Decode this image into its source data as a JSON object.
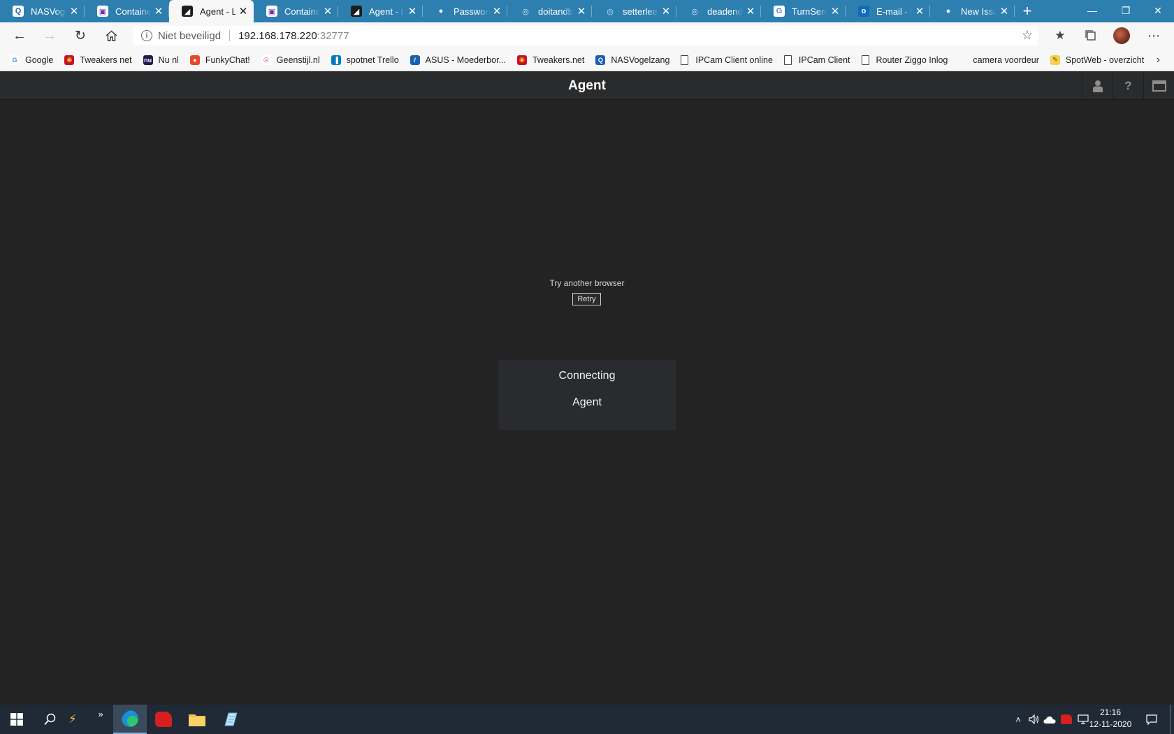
{
  "browser": {
    "tabs": [
      {
        "title": "NASVogelzang",
        "favicon": "nas-icon",
        "active": false
      },
      {
        "title": "Container",
        "favicon": "container-icon",
        "active": false
      },
      {
        "title": "Agent - Lo",
        "favicon": "agent-icon",
        "active": true
      },
      {
        "title": "Container",
        "favicon": "container-icon",
        "active": false
      },
      {
        "title": "Agent - Lo",
        "favicon": "agent-icon",
        "active": false
      },
      {
        "title": "Password",
        "favicon": "github-icon",
        "active": false
      },
      {
        "title": "doitandbe",
        "favicon": "docker-icon",
        "active": false
      },
      {
        "title": "setterlee/r",
        "favicon": "docker-icon",
        "active": false
      },
      {
        "title": "deadend/",
        "favicon": "docker-icon",
        "active": false
      },
      {
        "title": "TurnServe",
        "favicon": "google-icon",
        "active": false
      },
      {
        "title": "E-mail - M",
        "favicon": "outlook-icon",
        "active": false
      },
      {
        "title": "New Issue",
        "favicon": "github-icon",
        "active": false
      }
    ],
    "address": {
      "security_label": "Niet beveiligd",
      "host": "192.168.178.220",
      "port": ":32777"
    },
    "bookmarks": [
      {
        "label": "Google",
        "icon": "google-icon"
      },
      {
        "label": "Tweakers net",
        "icon": "tweakers-icon"
      },
      {
        "label": "Nu nl",
        "icon": "nu-icon"
      },
      {
        "label": "FunkyChat!",
        "icon": "funkychat-icon"
      },
      {
        "label": "Geenstijl.nl",
        "icon": "geenstijl-icon"
      },
      {
        "label": "spotnet  Trello",
        "icon": "trello-icon"
      },
      {
        "label": "ASUS - Moederbor...",
        "icon": "asus-icon"
      },
      {
        "label": "Tweakers.net",
        "icon": "tweakers-icon"
      },
      {
        "label": "NASVogelzang",
        "icon": "nas-icon"
      },
      {
        "label": "IPCam Client online",
        "icon": "page-icon"
      },
      {
        "label": "IPCam Client",
        "icon": "page-icon"
      },
      {
        "label": "Router Ziggo Inlog",
        "icon": "page-icon"
      },
      {
        "label": "camera voordeur",
        "icon": "none"
      },
      {
        "label": "SpotWeb - overzicht",
        "icon": "spotweb-icon"
      }
    ]
  },
  "app": {
    "title": "Agent",
    "message": "Try another browser",
    "retry_label": "Retry",
    "status_line1": "Connecting",
    "status_line2": "Agent"
  },
  "taskbar": {
    "time": "21:16",
    "date": "12-11-2020"
  },
  "colors": {
    "tabstrip": "#2d7fb0",
    "app_background": "#232323",
    "app_header": "#2a2b2d",
    "taskbar": "#1f2a36"
  }
}
